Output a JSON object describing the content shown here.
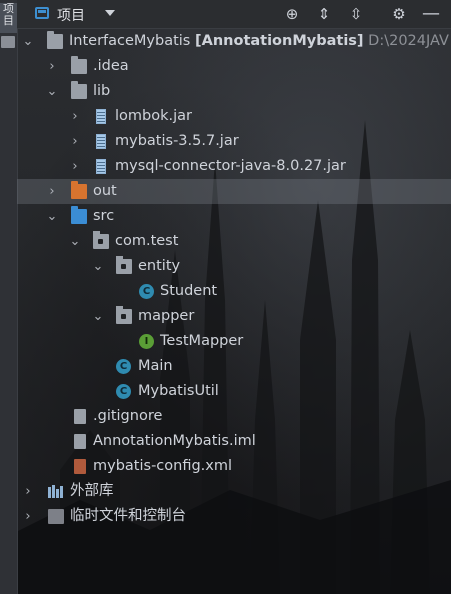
{
  "header": {
    "title": "项目",
    "side_label": "项目"
  },
  "toolbar": {
    "icons": [
      "locate-icon",
      "expand-all-icon",
      "collapse-all-icon",
      "settings-icon",
      "hide-icon"
    ]
  },
  "tree": {
    "root": {
      "name": "InterfaceMybatis",
      "module": "[AnnotationMybatis]",
      "path": "D:\\2024JAV"
    },
    "idea": ".idea",
    "lib": "lib",
    "jars": [
      "lombok.jar",
      "mybatis-3.5.7.jar",
      "mysql-connector-java-8.0.27.jar"
    ],
    "out": "out",
    "src": "src",
    "com_test": "com.test",
    "entity": "entity",
    "student": "Student",
    "mapper": "mapper",
    "test_mapper": "TestMapper",
    "main": "Main",
    "mybatis_util": "MybatisUtil",
    "gitignore": ".gitignore",
    "iml": "AnnotationMybatis.iml",
    "config": "mybatis-config.xml",
    "external_libs": "外部库",
    "scratches": "临时文件和控制台"
  },
  "colors": {
    "folder_blue": "#3b8dd4",
    "folder_orange": "#d7742f",
    "class_badge": "#2f8bb0",
    "interface_badge": "#5a9e36"
  }
}
